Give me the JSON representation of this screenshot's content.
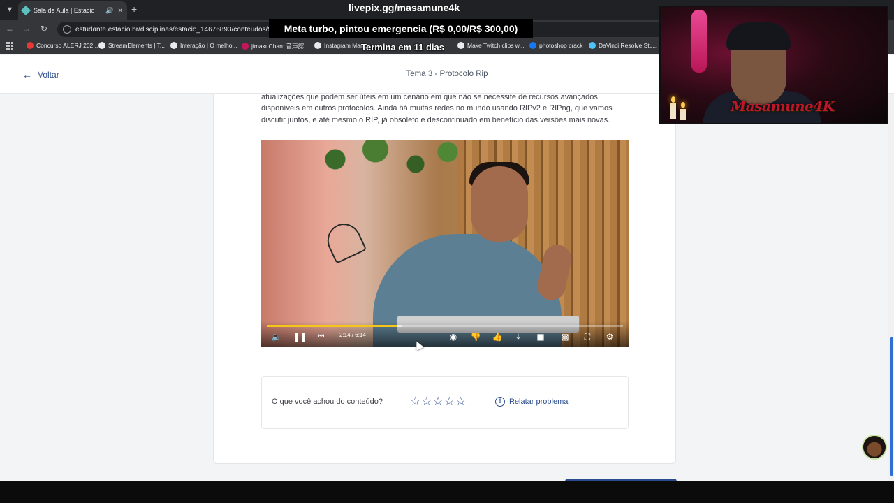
{
  "browser": {
    "tab_title": "Sala de Aula | Estacio",
    "url": "estudante.estacio.br/disciplinas/estacio_14676893/conteudos/91002",
    "bookmarks": [
      {
        "label": "Concurso ALERJ 202...",
        "color": "#e53935"
      },
      {
        "label": "StreamElements | T...",
        "color": "#e8eaed"
      },
      {
        "label": "Interação | O melho...",
        "color": "#e8eaed"
      },
      {
        "label": "jimakuChan: 音声認...",
        "color": "#c2185b"
      },
      {
        "label": "Instagram Man...",
        "color": "#e8eaed"
      },
      {
        "label": "Make Twitch clips w...",
        "color": "#e8eaed"
      },
      {
        "label": "photoshop crack",
        "color": "#1877f2"
      },
      {
        "label": "DaVinci Resolve Stu...",
        "color": "#4fc3f7"
      }
    ]
  },
  "overlay": {
    "url": "livepix.gg/masamune4k",
    "goal": "Meta turbo, pintou emergencia (R$ 0,00/R$ 300,00)",
    "ends": "Termina em 11 dias",
    "webcam_logo": "Masamune4K"
  },
  "header": {
    "back_label": "Voltar",
    "title": "Tema 3 - Protocolo Rip"
  },
  "content": {
    "paragraph": "atualizações que podem ser úteis em um cenário em que não se necessite de recursos avançados, disponíveis em outros protocolos. Ainda há muitas redes no mundo usando RIPv2 e RIPng, que vamos discutir juntos, e até mesmo o RIP, já obsoleto e descontinuado em benefício das versões mais novas."
  },
  "video": {
    "time": "2:14 / 6:14",
    "progress": 0.364,
    "buffered": 0.38
  },
  "feedback": {
    "question": "O que você achou do conteúdo?",
    "rating_max": 5,
    "rating": 0,
    "report_label": "Relatar problema"
  },
  "colors": {
    "accent": "#2b4c8c",
    "progress": "#f5c518"
  }
}
